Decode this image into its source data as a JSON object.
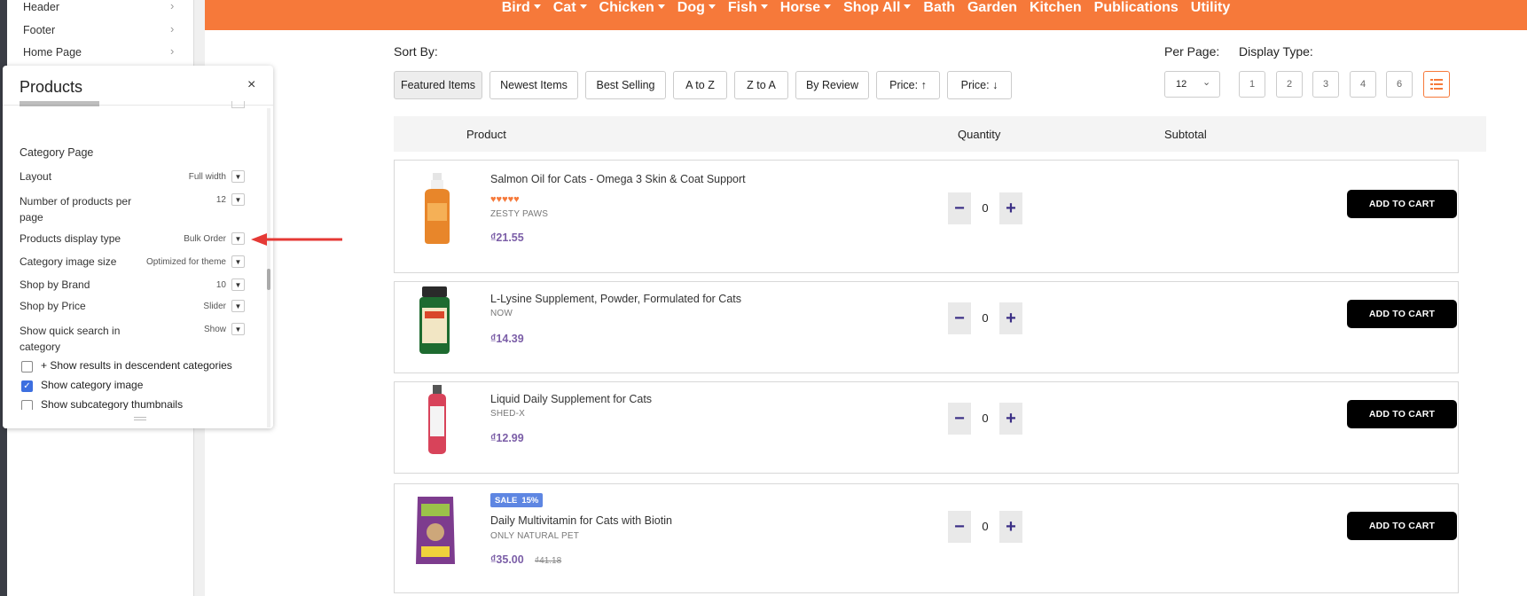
{
  "sidebar": {
    "items": [
      {
        "label": "Header"
      },
      {
        "label": "Footer"
      },
      {
        "label": "Home Page"
      }
    ]
  },
  "nav": {
    "items": [
      {
        "label": "Bird",
        "dropdown": true
      },
      {
        "label": "Cat",
        "dropdown": true
      },
      {
        "label": "Chicken",
        "dropdown": true
      },
      {
        "label": "Dog",
        "dropdown": true
      },
      {
        "label": "Fish",
        "dropdown": true
      },
      {
        "label": "Horse",
        "dropdown": true
      },
      {
        "label": "Shop All",
        "dropdown": true
      },
      {
        "label": "Bath",
        "dropdown": false
      },
      {
        "label": "Garden",
        "dropdown": false
      },
      {
        "label": "Kitchen",
        "dropdown": false
      },
      {
        "label": "Publications",
        "dropdown": false
      },
      {
        "label": "Utility",
        "dropdown": false
      }
    ]
  },
  "sort": {
    "label": "Sort By:",
    "options": [
      "Featured Items",
      "Newest Items",
      "Best Selling",
      "A to Z",
      "Z to A",
      "By Review",
      "Price: ↑",
      "Price: ↓"
    ],
    "active": "Featured Items"
  },
  "per_page": {
    "label": "Per Page:",
    "value": "12"
  },
  "display_type": {
    "label": "Display Type:",
    "options": [
      "1",
      "2",
      "3",
      "4",
      "6"
    ],
    "list_icon": "list-icon"
  },
  "table": {
    "headers": {
      "product": "Product",
      "quantity": "Quantity",
      "subtotal": "Subtotal"
    }
  },
  "products": [
    {
      "name": "Salmon Oil for Cats - Omega 3 Skin & Coat Support",
      "brand": "ZESTY PAWS",
      "price": "₫21.55",
      "rating": "♥♥♥♥♥",
      "qty": "0",
      "cart": "ADD TO CART"
    },
    {
      "name": "L-Lysine Supplement, Powder, Formulated for Cats",
      "brand": "NOW",
      "price": "₫14.39",
      "qty": "0",
      "cart": "ADD TO CART"
    },
    {
      "name": "Liquid Daily Supplement for Cats",
      "brand": "SHED-X",
      "price": "₫12.99",
      "qty": "0",
      "cart": "ADD TO CART"
    },
    {
      "name": "Daily Multivitamin for Cats with Biotin",
      "brand": "ONLY NATURAL PET",
      "price": "₫35.00",
      "old_price": "₫41.18",
      "badge_sale": "SALE",
      "badge_pct": "15%",
      "qty": "0",
      "cart": "ADD TO CART"
    }
  ],
  "panel": {
    "title": "Products",
    "close": "×",
    "section": "Category Page",
    "settings": [
      {
        "label": "Layout",
        "value": "Full width"
      },
      {
        "label": "Number of products per page",
        "value": "12"
      },
      {
        "label": "Products display type",
        "value": "Bulk Order"
      },
      {
        "label": "Category image size",
        "value": "Optimized for theme"
      },
      {
        "label": "Shop by Brand",
        "value": "10"
      },
      {
        "label": "Shop by Price",
        "value": "Slider"
      },
      {
        "label": "Show quick search in category",
        "value": "Show"
      }
    ],
    "checkboxes": [
      {
        "label": "+ Show results in descendent categories",
        "checked": false
      },
      {
        "label": "Show category image",
        "checked": true
      },
      {
        "label": "Show subcategory thumbnails",
        "checked": false
      }
    ]
  },
  "colors": {
    "accent": "#f6793a",
    "price": "#7b5ea7",
    "sale": "#5e86e2",
    "arrow": "#e53935"
  }
}
